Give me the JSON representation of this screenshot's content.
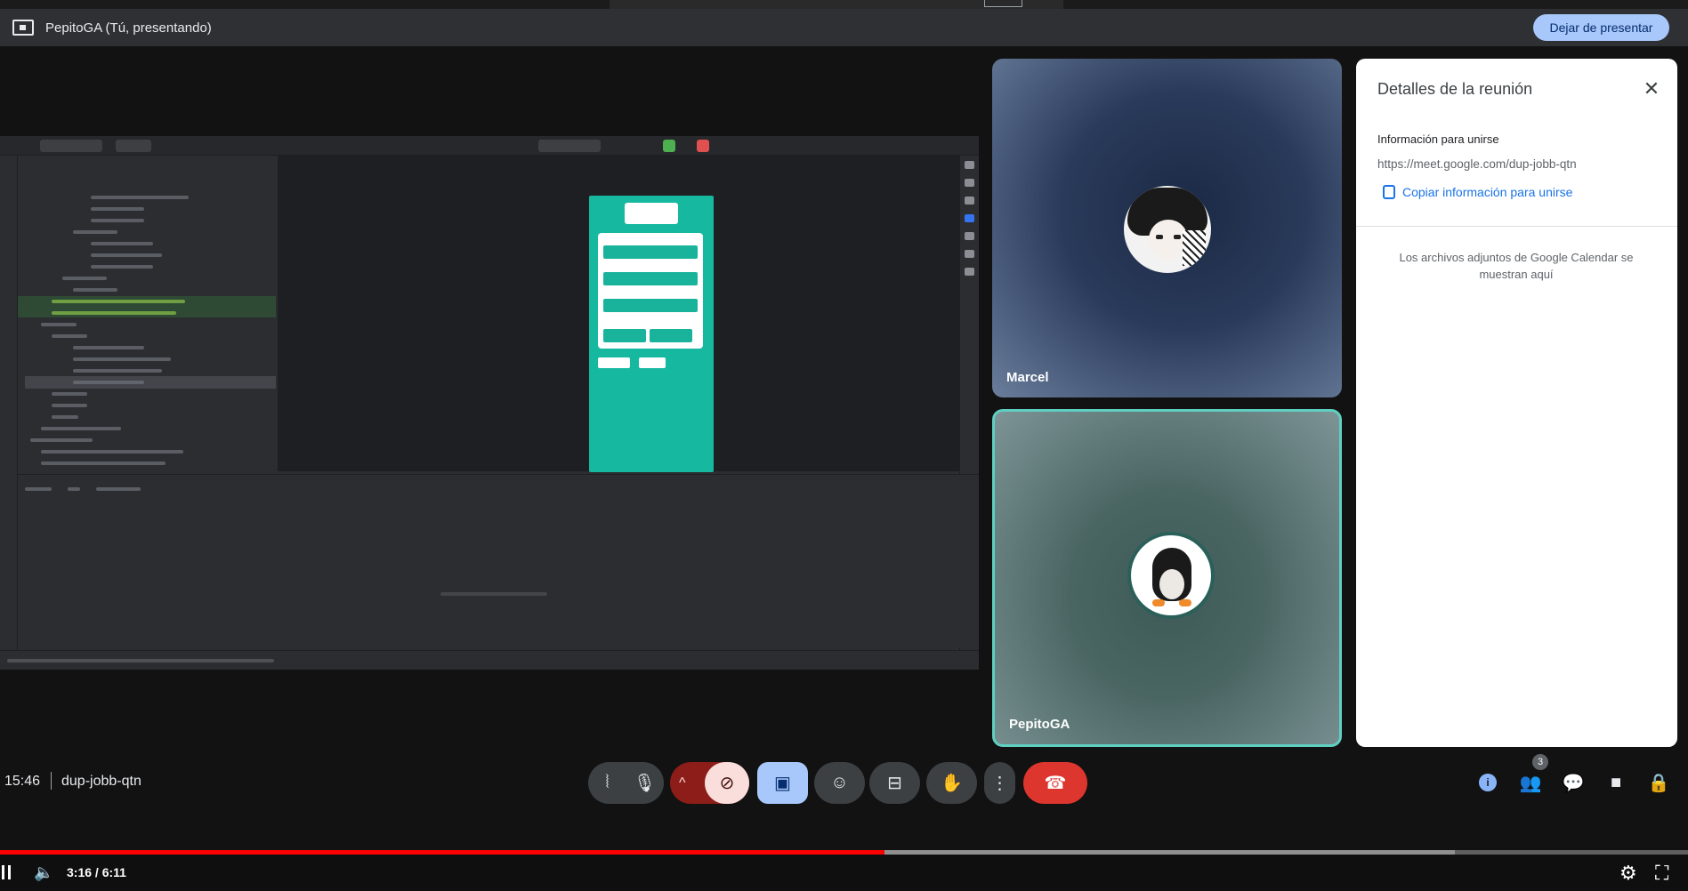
{
  "presentation": {
    "title": "PepitoGA (Tú, presentando)",
    "stop_label": "Dejar de presentar"
  },
  "participants": [
    {
      "name": "Marcel"
    },
    {
      "name": "PepitoGA"
    }
  ],
  "details_panel": {
    "title": "Detalles de la reunión",
    "join_heading": "Información para unirse",
    "link": "https://meet.google.com/dup-jobb-qtn",
    "copy_label": "Copiar información para unirse",
    "attachments_note": "Los archivos adjuntos de Google Calendar se muestran aquí"
  },
  "meeting": {
    "time": "15:46",
    "code": "dup-jobb-qtn",
    "participant_count": "3"
  },
  "icons": {
    "present": "present-screen-icon",
    "close": "close-icon",
    "copy": "copy-icon",
    "mic": "microphone-icon",
    "camera_off": "camera-off-icon",
    "emoji": "emoji-icon",
    "captions": "captions-icon",
    "raise_hand": "raise-hand-icon",
    "more": "more-vert-icon",
    "hang_up": "hang-up-icon",
    "info": "info-icon",
    "people": "people-icon",
    "chat": "chat-icon",
    "activities": "activities-icon",
    "host_controls": "lock-icon"
  },
  "player": {
    "time": "3:16 / 6:11",
    "played_fraction": 0.524,
    "buffered_fraction": 0.862
  },
  "colors": {
    "accent_blue": "#a8c7fa",
    "leave_red": "#dc362e",
    "progress_red": "#ff0000",
    "active_speaker": "#5fcfc2",
    "app_teal": "#17b8a0"
  }
}
